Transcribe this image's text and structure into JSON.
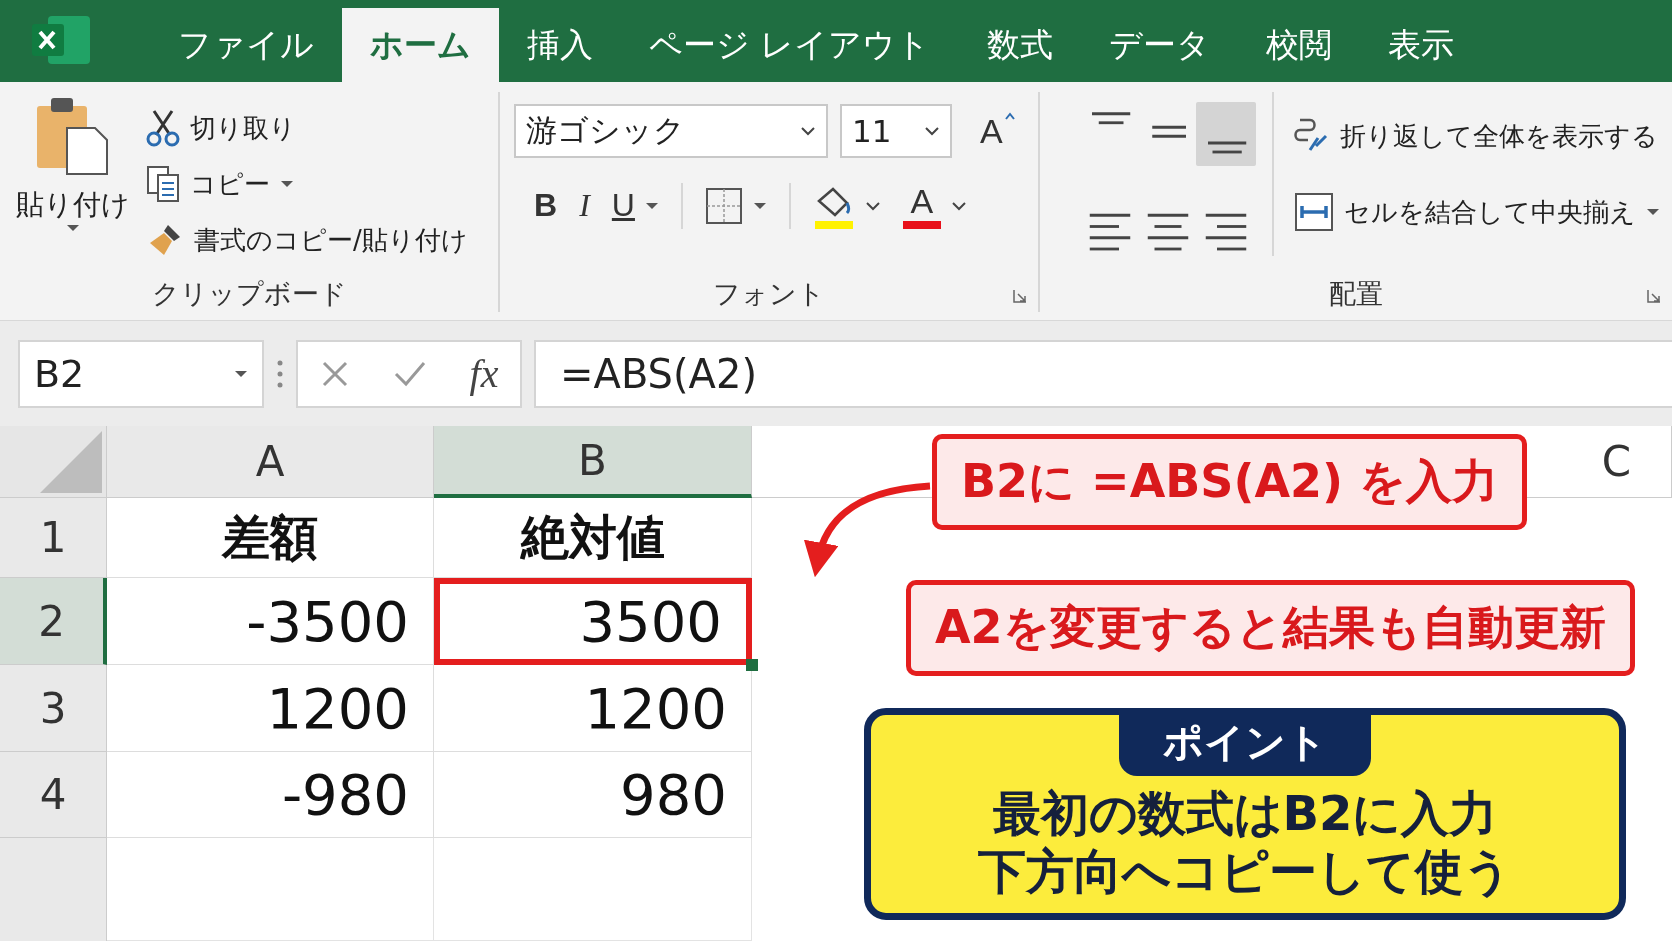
{
  "tabs": [
    {
      "label": "ファイル",
      "selected": false
    },
    {
      "label": "ホーム",
      "selected": true
    },
    {
      "label": "挿入",
      "selected": false
    },
    {
      "label": "ページ レイアウト",
      "selected": false
    },
    {
      "label": "数式",
      "selected": false
    },
    {
      "label": "データ",
      "selected": false
    },
    {
      "label": "校閲",
      "selected": false
    },
    {
      "label": "表示",
      "selected": false
    }
  ],
  "ribbon": {
    "clipboard": {
      "paste": "貼り付け",
      "items": [
        "切り取り",
        "コピー",
        "書式のコピー/貼り付け"
      ],
      "label": "クリップボード"
    },
    "font": {
      "name": "游ゴシック",
      "size": "11",
      "grow": "A",
      "bold": "B",
      "italic": "I",
      "underline": "U",
      "font_color": "A",
      "label": "フォント"
    },
    "alignment": {
      "vertical": [
        {
          "selected": false
        },
        {
          "selected": false
        },
        {
          "selected": true
        }
      ],
      "wrap": "折り返して全体を表示する",
      "merge": "セルを結合して中央揃え",
      "label": "配置"
    }
  },
  "formula_bar": {
    "name_box": "B2",
    "fx": "fx",
    "formula": "=ABS(A2)"
  },
  "sheet": {
    "columns": [
      {
        "label": "A",
        "selected": false
      },
      {
        "label": "B",
        "selected": true
      },
      {
        "label": "C",
        "selected": false
      }
    ],
    "rows": [
      {
        "header": "1",
        "selected": false,
        "kind": "heading",
        "cells": [
          {
            "text": "差額",
            "selected": false
          },
          {
            "text": "絶対値",
            "selected": false
          }
        ]
      },
      {
        "header": "2",
        "selected": true,
        "kind": "value",
        "cells": [
          {
            "text": "-3500",
            "selected": false
          },
          {
            "text": "3500",
            "selected": true
          }
        ]
      },
      {
        "header": "3",
        "selected": false,
        "kind": "value",
        "cells": [
          {
            "text": "1200",
            "selected": false
          },
          {
            "text": "1200",
            "selected": false
          }
        ]
      },
      {
        "header": "4",
        "selected": false,
        "kind": "value",
        "cells": [
          {
            "text": "-980",
            "selected": false
          },
          {
            "text": "980",
            "selected": false
          }
        ]
      }
    ]
  },
  "callouts": [
    {
      "kind": "arrow",
      "text": "B2に =ABS(A2) を入力"
    },
    {
      "kind": "plain",
      "text": "A2を変更すると結果も自動更新"
    }
  ],
  "point": {
    "badge": "ポイント",
    "lines": [
      "最初の数式はB2に入力",
      "下方向へコピーして使う"
    ]
  }
}
